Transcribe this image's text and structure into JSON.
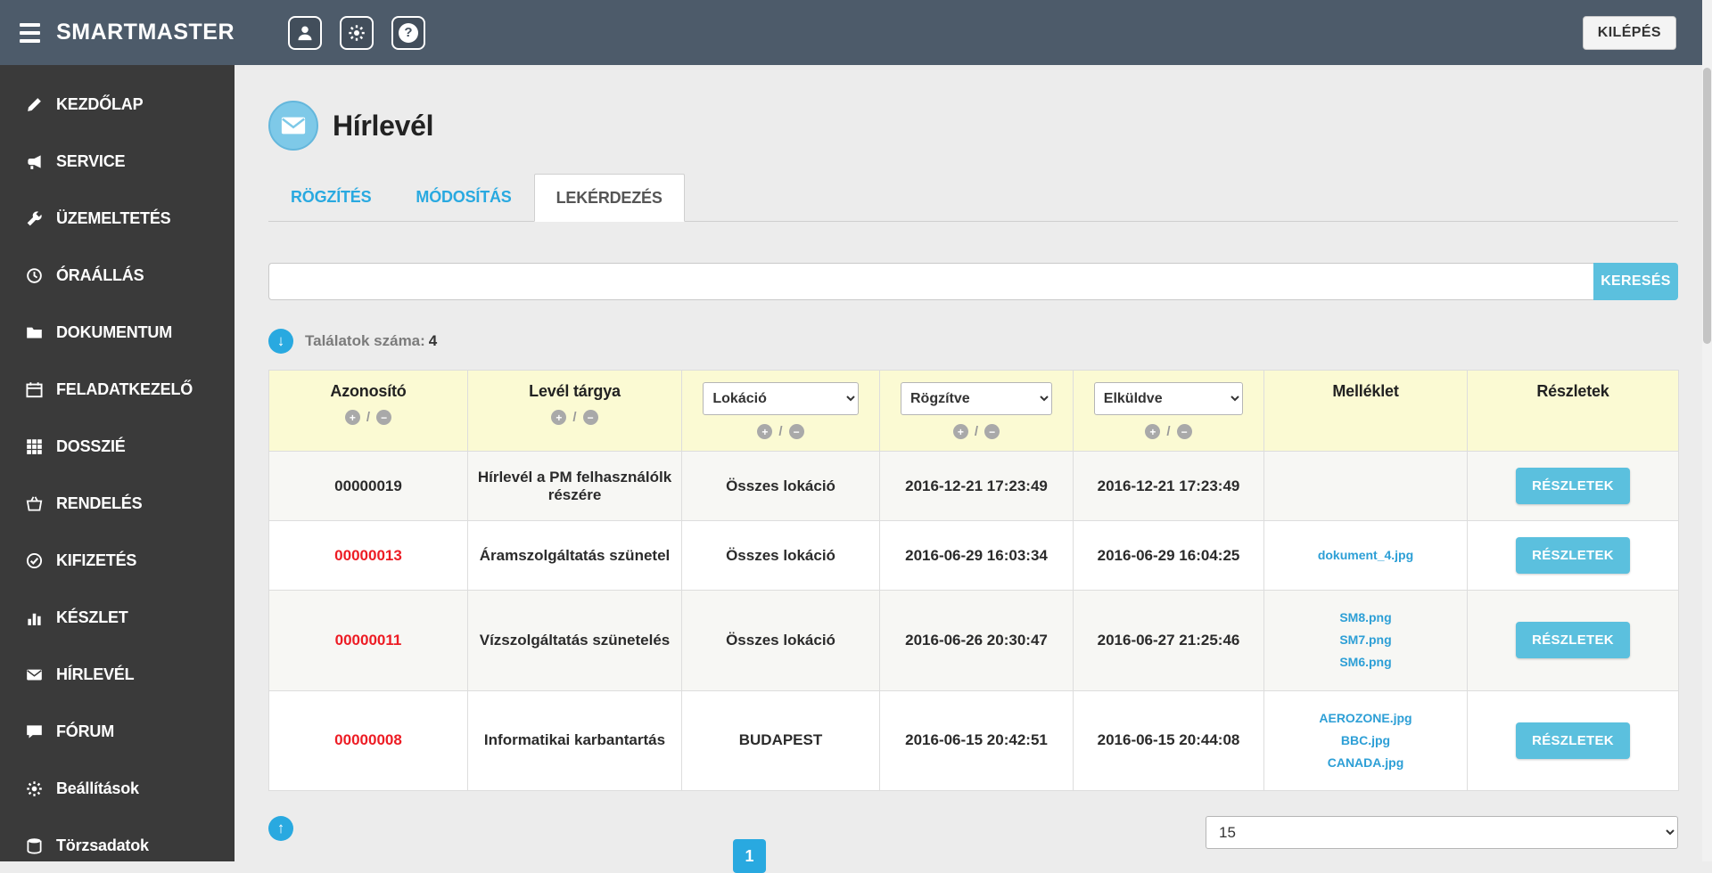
{
  "topbar": {
    "brand": "SMARTMASTER",
    "logout_label": "KILÉPÉS"
  },
  "sidebar": {
    "items": [
      {
        "label": "KEZDŐLAP",
        "icon": "pencil-icon"
      },
      {
        "label": "SERVICE",
        "icon": "megaphone-icon"
      },
      {
        "label": "ÜZEMELTETÉS",
        "icon": "wrench-icon"
      },
      {
        "label": "ÓRAÁLLÁS",
        "icon": "clock-icon"
      },
      {
        "label": "DOKUMENTUM",
        "icon": "folder-icon"
      },
      {
        "label": "FELADATKEZELŐ",
        "icon": "calendar-icon"
      },
      {
        "label": "DOSSZIÉ",
        "icon": "grid-icon"
      },
      {
        "label": "RENDELÉS",
        "icon": "basket-icon"
      },
      {
        "label": "KIFIZETÉS",
        "icon": "check-circle-icon"
      },
      {
        "label": "KÉSZLET",
        "icon": "bar-chart-icon"
      },
      {
        "label": "HÍRLEVÉL",
        "icon": "envelope-icon"
      },
      {
        "label": "FÓRUM",
        "icon": "comment-icon"
      },
      {
        "label": "Beállítások",
        "icon": "gear-icon"
      },
      {
        "label": "Törzsadatok",
        "icon": "database-icon"
      }
    ]
  },
  "page": {
    "title": "Hírlevél",
    "tabs": [
      {
        "label": "RÖGZÍTÉS",
        "active": false
      },
      {
        "label": "MÓDOSÍTÁS",
        "active": false
      },
      {
        "label": "LEKÉRDEZÉS",
        "active": true
      }
    ],
    "search": {
      "value": "",
      "button_label": "KERESÉS"
    },
    "results_label": "Találatok száma:",
    "results_count": "4"
  },
  "table": {
    "columns": [
      {
        "label": "Azonosító",
        "type": "sort"
      },
      {
        "label": "Levél tárgya",
        "type": "sort"
      },
      {
        "label": "Lokáció",
        "type": "filter"
      },
      {
        "label": "Rögzítve",
        "type": "filter"
      },
      {
        "label": "Elküldve",
        "type": "filter"
      },
      {
        "label": "Melléklet",
        "type": "plain"
      },
      {
        "label": "Részletek",
        "type": "plain"
      }
    ],
    "details_button_label": "RÉSZLETEK",
    "rows": [
      {
        "id": "00000019",
        "id_highlight": false,
        "subject": "Hírlevél a PM felhasználólk részére",
        "location": "Összes lokáció",
        "recorded": "2016-12-21 17:23:49",
        "sent": "2016-12-21 17:23:49",
        "attachments": []
      },
      {
        "id": "00000013",
        "id_highlight": true,
        "subject": "Áramszolgáltatás szünetel",
        "location": "Összes lokáció",
        "recorded": "2016-06-29 16:03:34",
        "sent": "2016-06-29 16:04:25",
        "attachments": [
          "dokument_4.jpg"
        ]
      },
      {
        "id": "00000011",
        "id_highlight": true,
        "subject": "Vízszolgáltatás szünetelés",
        "location": "Összes lokáció",
        "recorded": "2016-06-26 20:30:47",
        "sent": "2016-06-27 21:25:46",
        "attachments": [
          "SM8.png",
          "SM7.png",
          "SM6.png"
        ]
      },
      {
        "id": "00000008",
        "id_highlight": true,
        "subject": "Informatikai karbantartás",
        "location": "BUDAPEST",
        "recorded": "2016-06-15 20:42:51",
        "sent": "2016-06-15 20:44:08",
        "attachments": [
          "AEROZONE.jpg",
          "BBC.jpg",
          "CANADA.jpg"
        ]
      }
    ]
  },
  "pagination": {
    "current_page": "1",
    "page_size": "15"
  },
  "colors": {
    "topbar": "#4d5b6a",
    "sidebar": "#3a3a3a",
    "accent": "#5bc0de",
    "tab_link_blue": "#29a9e0",
    "attachment_link": "#2d9fd6",
    "highlight_red": "#ed1c24",
    "table_header_bg": "#fbfad3"
  }
}
